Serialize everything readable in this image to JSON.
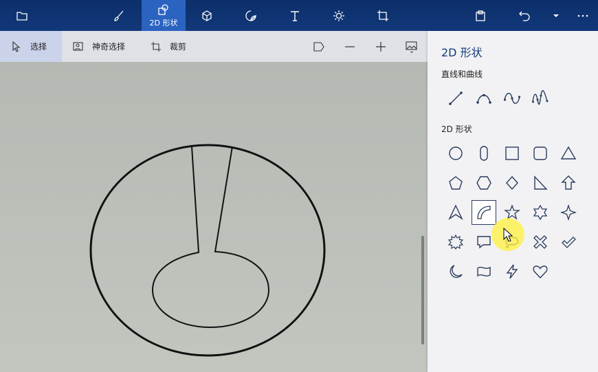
{
  "topbar": {
    "tools": [
      {
        "name": "folder-icon"
      },
      {
        "name": "brush-icon"
      },
      {
        "name": "shapes-2d-icon",
        "label": "2D 形状",
        "active": true
      },
      {
        "name": "cube-3d-icon"
      },
      {
        "name": "sticker-icon"
      },
      {
        "name": "text-icon"
      },
      {
        "name": "effects-icon"
      },
      {
        "name": "canvas-crop-icon"
      },
      {
        "name": "paste-icon"
      },
      {
        "name": "undo-icon"
      },
      {
        "name": "history-dropdown-icon"
      },
      {
        "name": "more-icon"
      }
    ]
  },
  "toolbar": {
    "select_label": "选择",
    "magic_select_label": "神奇选择",
    "crop_label": "裁剪"
  },
  "panel": {
    "title": "2D 形状",
    "lines_section": "直线和曲线",
    "shapes_section": "2D 形状",
    "line_tools": [
      "line-icon",
      "curve-icon",
      "s-curve-icon",
      "double-curve-icon"
    ],
    "shape_rows": [
      [
        "circle-icon",
        "capsule-icon",
        "square-icon",
        "rounded-square-icon",
        "triangle-icon"
      ],
      [
        "pentagon-icon",
        "hexagon-icon",
        "diamond-icon",
        "right-triangle-icon",
        "arrow-up-icon"
      ],
      [
        "arrowhead-icon",
        "quarter-circle-icon",
        "star-5-icon",
        "star-6-icon",
        "star-4-icon"
      ],
      [
        "burst-icon",
        "speech-bubble-icon",
        "thought-bubble-icon",
        "x-icon",
        "checkmark-icon"
      ],
      [
        "moon-icon",
        "banner-icon",
        "lightning-icon",
        "heart-icon"
      ]
    ],
    "selected_shape": "quarter-circle-icon"
  },
  "colors": {
    "topbar": "#0c2f6a",
    "active_tab": "#2b63c0",
    "panel_bg": "#f2f2f4",
    "canvas_bg": "#b9bdb7"
  }
}
